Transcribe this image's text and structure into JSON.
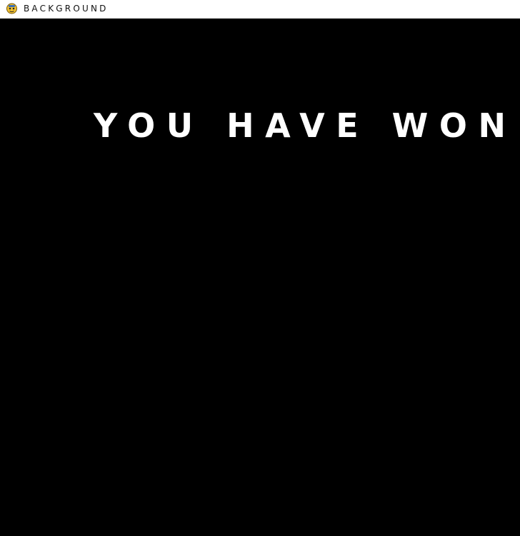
{
  "window": {
    "title": "BACKGROUND",
    "icon": "pygame-snake-icon"
  },
  "game": {
    "message": "YOU HAVE WON",
    "background_color": "#000000",
    "text_color": "#ffffff"
  }
}
